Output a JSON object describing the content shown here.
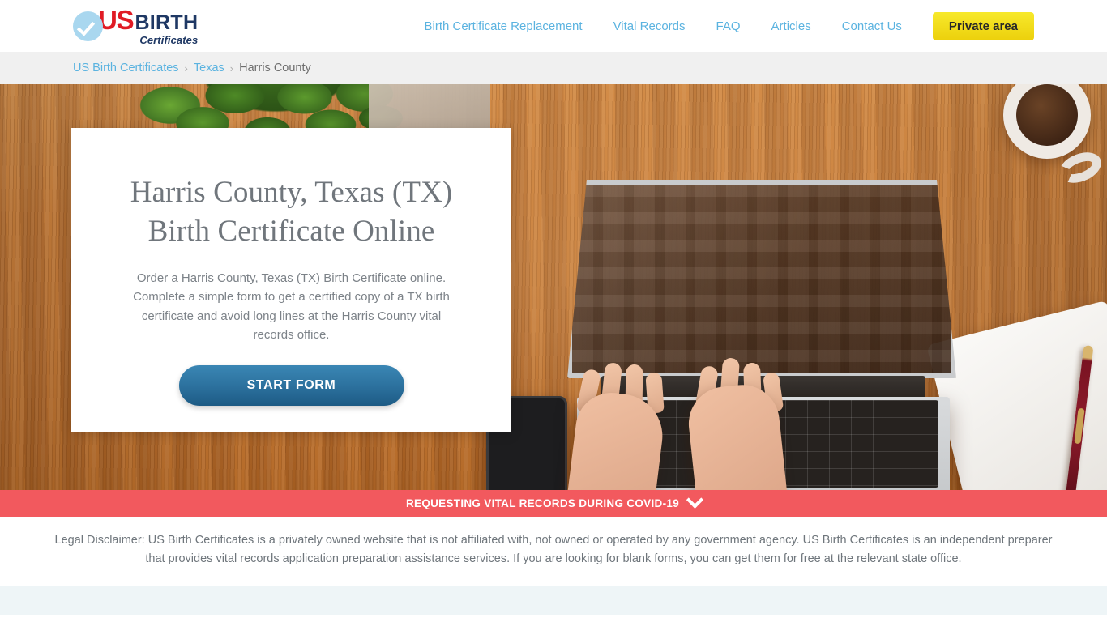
{
  "header": {
    "logo": {
      "check_icon": "check-circle-icon",
      "us": "US",
      "birth": "BIRTH",
      "certificates": "Certificates"
    },
    "nav": [
      {
        "label": "Birth Certificate Replacement"
      },
      {
        "label": "Vital Records"
      },
      {
        "label": "FAQ"
      },
      {
        "label": "Articles"
      },
      {
        "label": "Contact Us"
      }
    ],
    "private_area_label": "Private area"
  },
  "breadcrumb": {
    "items": [
      {
        "label": "US Birth Certificates",
        "type": "link"
      },
      {
        "label": "Texas",
        "type": "link"
      },
      {
        "label": "Harris County",
        "type": "current"
      }
    ],
    "separator": "›"
  },
  "hero": {
    "title_line1": "Harris County, Texas (TX)",
    "title_line2": "Birth Certificate Online",
    "subtitle": "Order a Harris County, Texas (TX) Birth Certificate online. Complete a simple form to get a certified copy of a TX birth certificate and avoid long lines at the Harris County vital records office.",
    "cta_label": "START FORM",
    "background_description": "Overhead photo of hands typing on a laptop on a wooden desk with coffee cup, plant, tablet, notebook and pen"
  },
  "covid_banner": {
    "text": "REQUESTING VITAL RECORDS DURING COVID-19",
    "toggle_icon": "chevron-down-icon"
  },
  "disclaimer": {
    "text": "Legal Disclaimer: US Birth Certificates is a privately owned website that is not affiliated with, not owned or operated by any government agency. US Birth Certificates is an independent preparer that provides vital records application preparation assistance services. If you are looking for blank forms, you can get them for free at the relevant state office."
  },
  "colors": {
    "nav_link": "#5bb3e0",
    "brand_red": "#e01b24",
    "brand_navy": "#1f3864",
    "private_area_yellow": "#ecd00c",
    "cta_blue": "#2e74a1",
    "covid_red": "#f2595e",
    "breadcrumb_bar": "#f0f0f0",
    "next_section": "#eef5f7"
  }
}
